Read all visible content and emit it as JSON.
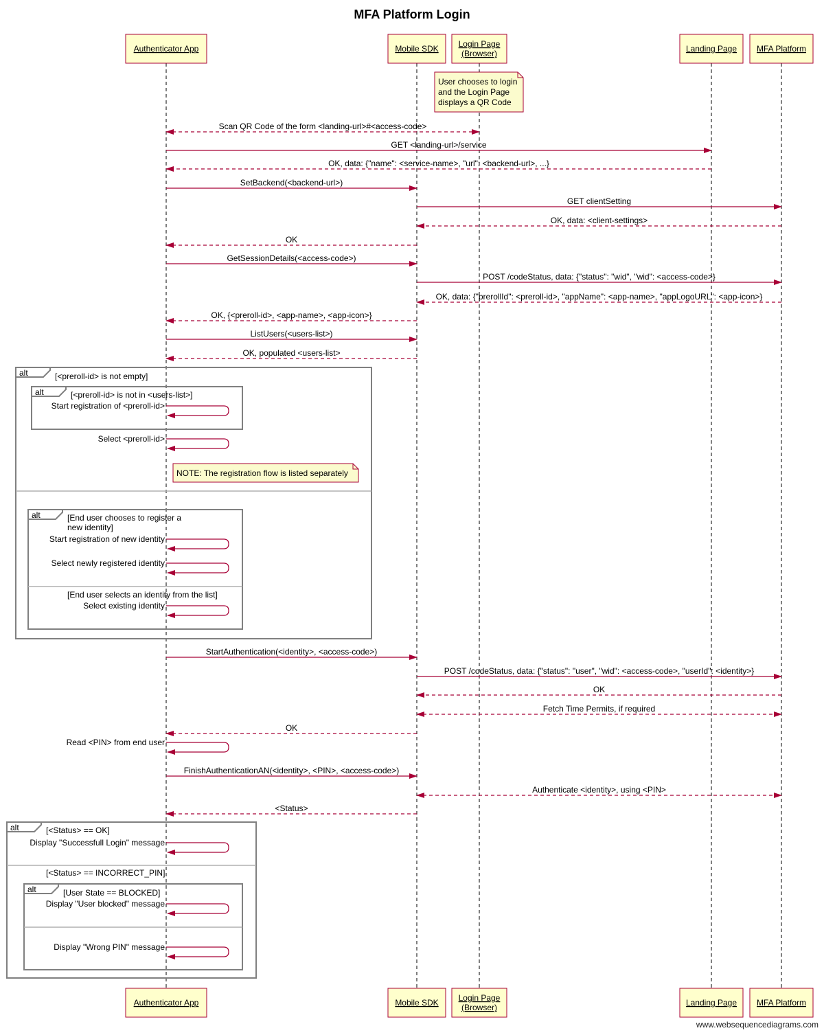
{
  "title": "MFA Platform Login",
  "footer": "www.websequencediagrams.com",
  "colors": {
    "participant_fill": "#ffffcc",
    "participant_border": "#a80036",
    "arrow": "#a80036",
    "note_fill": "#fbfbcd",
    "frame": "#808080",
    "lifeline": "#000000"
  },
  "participants": [
    {
      "id": "auth",
      "label": [
        "Authenticator App"
      ]
    },
    {
      "id": "sdk",
      "label": [
        "Mobile SDK"
      ]
    },
    {
      "id": "login",
      "label": [
        "Login Page",
        "(Browser)"
      ]
    },
    {
      "id": "landing",
      "label": [
        "Landing Page"
      ]
    },
    {
      "id": "mfa",
      "label": [
        "MFA Platform"
      ]
    }
  ],
  "notes": [
    {
      "id": "note-qr",
      "over": "login",
      "lines": [
        "User chooses to login",
        "and the Login Page",
        "displays a QR Code"
      ]
    },
    {
      "id": "note-registration",
      "over": "auth",
      "lines": [
        "NOTE: The registration flow is listed separately"
      ]
    }
  ],
  "messages": [
    {
      "from": "auth",
      "to": "login",
      "text": "Scan QR Code of the form <landing-url>#<access-code>",
      "style": "dashed",
      "bidirectional": true
    },
    {
      "from": "auth",
      "to": "landing",
      "text": "GET <landing-url>/service",
      "style": "solid"
    },
    {
      "from": "landing",
      "to": "auth",
      "text": "OK, data: {\"name\": <service-name>, \"url\": <backend-url>, ...}",
      "style": "dashed"
    },
    {
      "from": "auth",
      "to": "sdk",
      "text": "SetBackend(<backend-url>)",
      "style": "solid"
    },
    {
      "from": "sdk",
      "to": "mfa",
      "text": "GET clientSetting",
      "style": "solid"
    },
    {
      "from": "mfa",
      "to": "sdk",
      "text": "OK, data: <client-settings>",
      "style": "dashed"
    },
    {
      "from": "sdk",
      "to": "auth",
      "text": "OK",
      "style": "dashed"
    },
    {
      "from": "auth",
      "to": "sdk",
      "text": "GetSessionDetails(<access-code>)",
      "style": "solid"
    },
    {
      "from": "sdk",
      "to": "mfa",
      "text": "POST /codeStatus, data: {\"status\": \"wid\", \"wid\": <access-code>}",
      "style": "solid"
    },
    {
      "from": "mfa",
      "to": "sdk",
      "text": "OK, data: {\"prerollId\": <preroll-id>, \"appName\": <app-name>, \"appLogoURL\": <app-icon>}",
      "style": "dashed"
    },
    {
      "from": "sdk",
      "to": "auth",
      "text": "OK, {<preroll-id>, <app-name>, <app-icon>}",
      "style": "dashed"
    },
    {
      "from": "auth",
      "to": "sdk",
      "text": "ListUsers(<users-list>)",
      "style": "solid"
    },
    {
      "from": "sdk",
      "to": "auth",
      "text": "OK, populated <users-list>",
      "style": "dashed"
    },
    {
      "from": "auth",
      "to": "auth",
      "text": "Start registration of <preroll-id>",
      "style": "self"
    },
    {
      "from": "auth",
      "to": "auth",
      "text": "Select <preroll-id>",
      "style": "self"
    },
    {
      "from": "auth",
      "to": "auth",
      "text": "Start registration of new identity",
      "style": "self"
    },
    {
      "from": "auth",
      "to": "auth",
      "text": "Select newly registered identity",
      "style": "self"
    },
    {
      "from": "auth",
      "to": "auth",
      "text": "Select existing identity",
      "style": "self"
    },
    {
      "from": "auth",
      "to": "sdk",
      "text": "StartAuthentication(<identity>, <access-code>)",
      "style": "solid"
    },
    {
      "from": "sdk",
      "to": "mfa",
      "text": "POST /codeStatus, data: {\"status\": \"user\", \"wid\": <access-code>, \"userId\": <identity>}",
      "style": "solid"
    },
    {
      "from": "mfa",
      "to": "sdk",
      "text": "OK",
      "style": "dashed"
    },
    {
      "from": "sdk",
      "to": "mfa",
      "text": "Fetch Time Permits, if required",
      "style": "dashed",
      "bidirectional": true
    },
    {
      "from": "sdk",
      "to": "auth",
      "text": "OK",
      "style": "dashed"
    },
    {
      "from": "auth",
      "to": "auth",
      "text": "Read <PIN> from end user",
      "style": "self"
    },
    {
      "from": "auth",
      "to": "sdk",
      "text": "FinishAuthenticationAN(<identity>, <PIN>, <access-code>)",
      "style": "solid"
    },
    {
      "from": "sdk",
      "to": "mfa",
      "text": "Authenticate <identity>, using <PIN>",
      "style": "dashed",
      "bidirectional": true
    },
    {
      "from": "sdk",
      "to": "auth",
      "text": "<Status>",
      "style": "dashed"
    },
    {
      "from": "auth",
      "to": "auth",
      "text": "Display \"Successfull Login\" message",
      "style": "self"
    },
    {
      "from": "auth",
      "to": "auth",
      "text": "Display \"User blocked\" message",
      "style": "self"
    },
    {
      "from": "auth",
      "to": "auth",
      "text": "Display \"Wrong PIN\" message",
      "style": "self"
    }
  ],
  "frames": [
    {
      "id": "alt-preroll",
      "keyword": "alt",
      "guards": [
        "[<preroll-id> is not empty]",
        ""
      ]
    },
    {
      "id": "alt-not-in-list",
      "keyword": "alt",
      "guards": [
        "[<preroll-id> is not in <users-list>]"
      ]
    },
    {
      "id": "alt-new-identity",
      "keyword": "alt",
      "guards": [
        "[End user chooses to register a new identity]",
        "[End user selects an identity from the list]"
      ]
    },
    {
      "id": "alt-status",
      "keyword": "alt",
      "guards": [
        "[<Status> == OK]",
        "[<Status> == INCORRECT_PIN]"
      ]
    },
    {
      "id": "alt-blocked",
      "keyword": "alt",
      "guards": [
        "[User State == BLOCKED]",
        ""
      ]
    }
  ]
}
